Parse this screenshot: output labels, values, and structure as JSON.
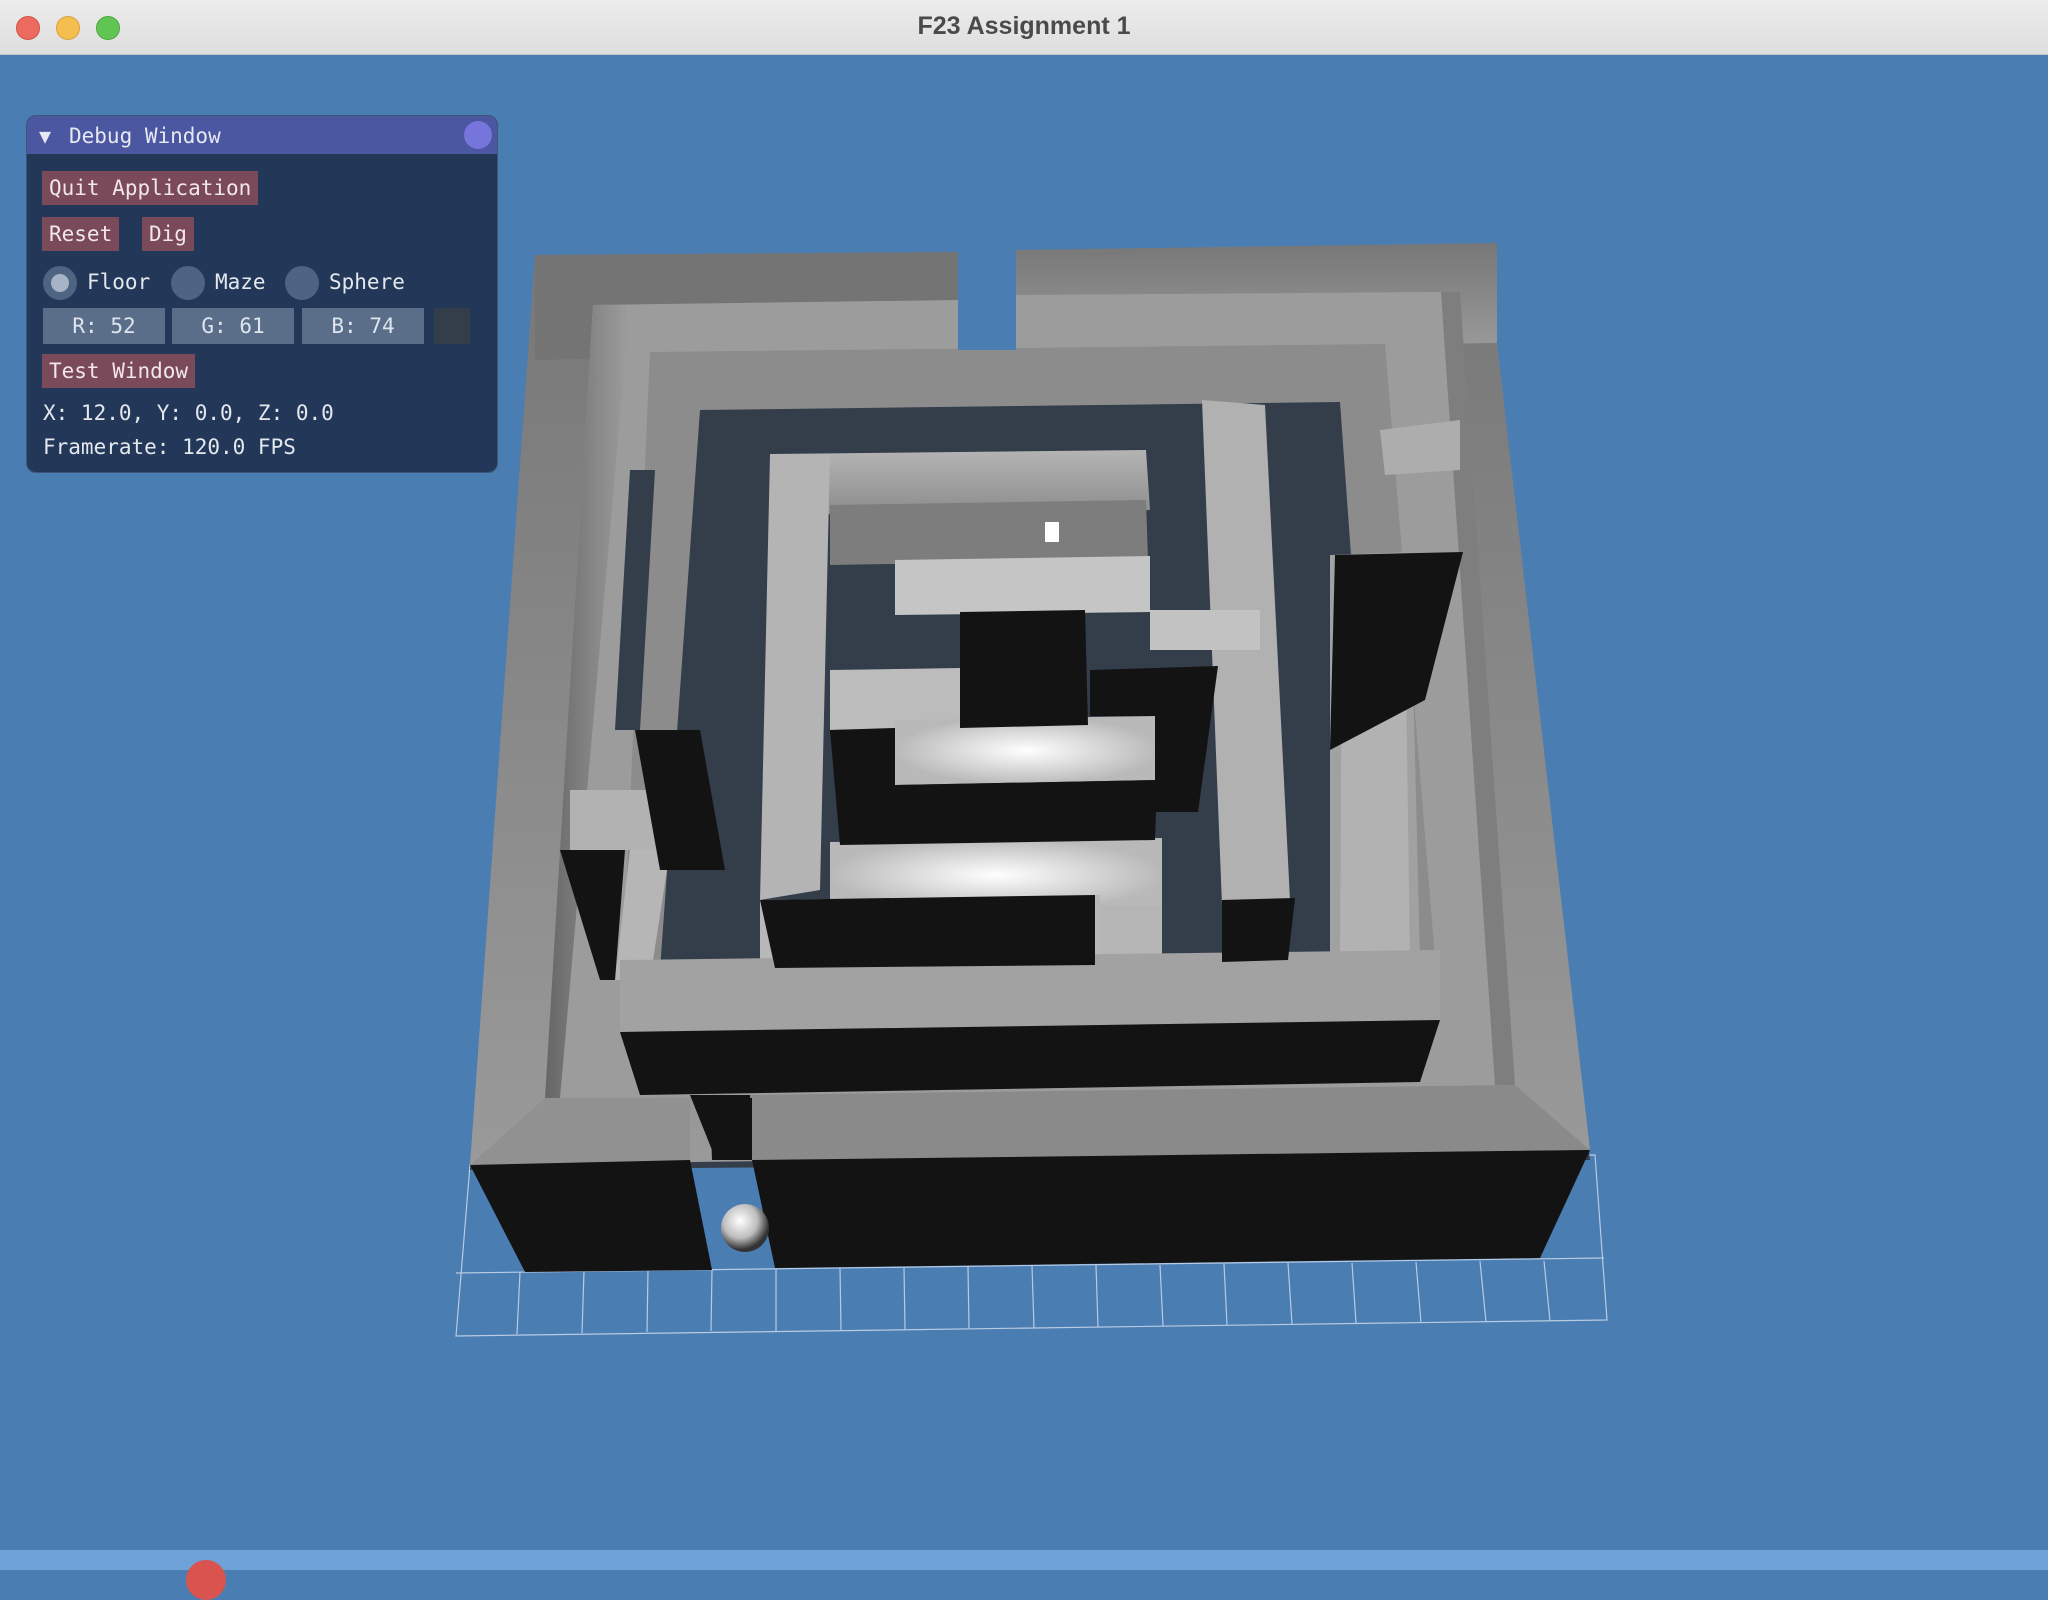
{
  "window": {
    "title": "F23 Assignment 1"
  },
  "debug_window": {
    "title": "Debug Window",
    "buttons": {
      "quit": "Quit Application",
      "reset": "Reset",
      "dig": "Dig",
      "test_window": "Test Window"
    },
    "radio": {
      "floor": "Floor",
      "maze": "Maze",
      "sphere": "Sphere",
      "selected": "Floor"
    },
    "color": {
      "r": "R: 52",
      "g": "G: 61",
      "b": "B: 74",
      "swatch": "#343d4a"
    },
    "position": "X: 12.0, Y: 0.0, Z: 0.0",
    "framerate": "Framerate: 120.0 FPS"
  },
  "colors": {
    "background": "#4a7db2",
    "wall_top": "#8a8a8a",
    "wall_shadow": "#131313",
    "floor": "#343d4a",
    "panel": "#213452",
    "button": "#7a4a5b",
    "title_bar": "#4b57a0"
  }
}
